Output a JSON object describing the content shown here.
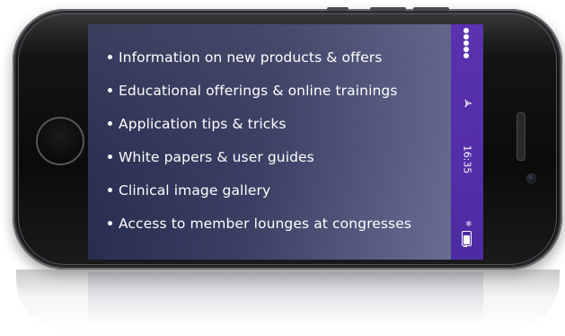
{
  "screen": {
    "items": [
      "Information on new products & offers",
      "Educational offerings & online trainings",
      "Application tips & tricks",
      "White papers & user guides",
      "Clinical image gallery",
      "Access to member lounges at congresses"
    ]
  },
  "status_bar": {
    "time": "16:35",
    "icons": [
      "signal-dots-icon",
      "wifi-icon",
      "bluetooth-icon",
      "battery-icon"
    ]
  },
  "colors": {
    "screen_gradient_start": "#23294b",
    "screen_gradient_end": "#6f7497",
    "status_bar": "#5a33b0",
    "text": "#ffffff"
  }
}
